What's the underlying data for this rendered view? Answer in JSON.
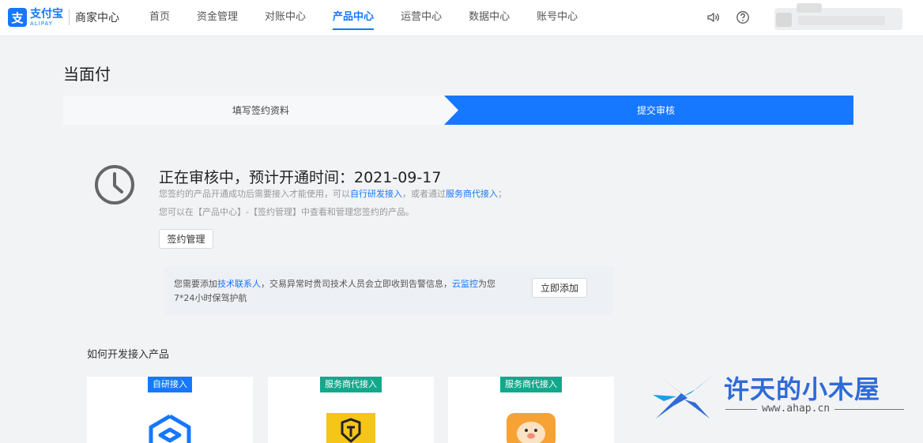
{
  "header": {
    "logo_cn": "支付宝",
    "logo_en": "ALIPAY",
    "logo_icon": "alipay-logo",
    "brand_sub": "商家中心",
    "nav": [
      "首页",
      "资金管理",
      "对账中心",
      "产品中心",
      "运营中心",
      "数据中心",
      "账号中心"
    ],
    "active_nav": "产品中心",
    "icons": [
      "speaker-icon",
      "help-icon",
      "avatar"
    ]
  },
  "page": {
    "title": "当面付"
  },
  "steps": {
    "step1": "填写签约资料",
    "step2": "提交审核"
  },
  "status": {
    "title": "正在审核中，预计开通时间：2021-09-17",
    "line1_a": "您签约的产品开通成功后需要接入才能使用，可以",
    "line1_link1": "自行研发接入",
    "line1_b": "，或者通过",
    "line1_link2": "服务商代接入",
    "line1_c": "；",
    "line2": "您可以在【产品中心】-【签约管理】中查看和管理您签约的产品。",
    "manage_button": "签约管理"
  },
  "notice": {
    "text_a": "您需要添加",
    "link1": "技术联系人",
    "text_b": "，交易异常时贵司技术人员会立即收到告警信息，",
    "link2": "云监控",
    "text_c": "为您7*24小时保驾护航",
    "add_button": "立即添加"
  },
  "section": {
    "title": "如何开发接入产品",
    "cards": [
      {
        "badge": "自研接入",
        "icon": "self-develop-icon",
        "badge_color": "#1677ff"
      },
      {
        "badge": "服务商代接入",
        "icon": "isv-shield-icon",
        "badge_color": "#13a88b"
      },
      {
        "badge": "服务商代接入",
        "icon": "isv-mascot-icon",
        "badge_color": "#13a88b"
      }
    ]
  },
  "watermark": {
    "text": "许天的小木屋",
    "url": "www.ahap.cn"
  },
  "colors": {
    "primary": "#1677ff",
    "teal": "#13a88b",
    "background": "#f2f3f5"
  }
}
